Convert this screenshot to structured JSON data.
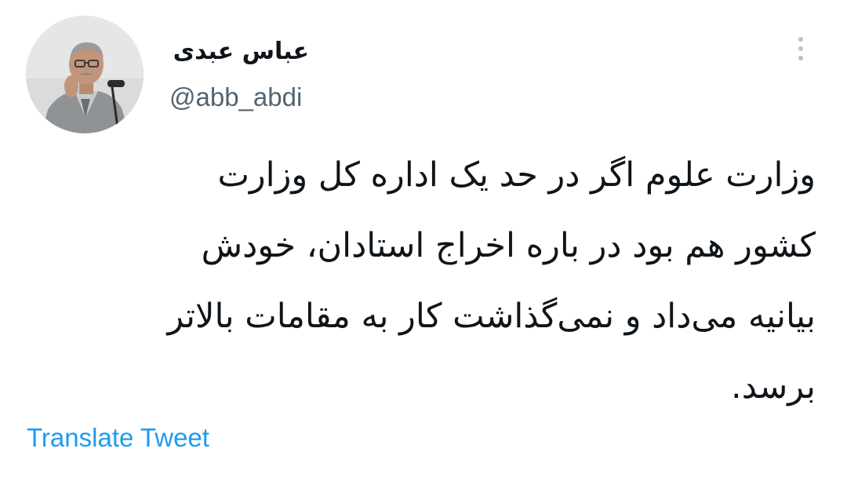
{
  "author": {
    "display_name": "عباس عبدی",
    "handle": "@abb_abdi",
    "avatar_icon": "profile-photo"
  },
  "tweet": {
    "lines": [
      "وزارت علوم اگر در حد یک اداره کل وزارت",
      "کشور هم بود در باره اخراج استادان، خودش",
      "بیانیه می‌داد و نمی‌گذاشت کار به مقامات بالاتر",
      "برسد."
    ],
    "translate_label": "Translate Tweet"
  },
  "menu": {
    "icon": "vertical-dots-icon"
  },
  "colors": {
    "text": "#0f1419",
    "secondary": "#536471",
    "link": "#1d9bf0",
    "menu_dots": "#b9c2cb"
  }
}
